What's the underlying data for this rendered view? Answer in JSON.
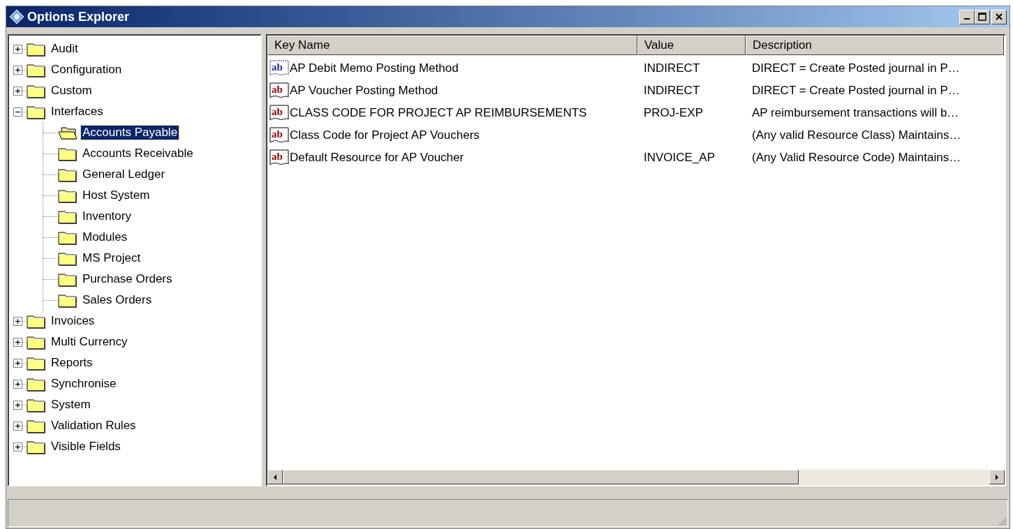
{
  "window": {
    "title": "Options Explorer"
  },
  "tree": [
    {
      "label": "Audit",
      "expanded": false,
      "selected": false
    },
    {
      "label": "Configuration",
      "expanded": false,
      "selected": false
    },
    {
      "label": "Custom",
      "expanded": false,
      "selected": false
    },
    {
      "label": "Interfaces",
      "expanded": true,
      "selected": false,
      "children": [
        {
          "label": "Accounts Payable",
          "selected": true
        },
        {
          "label": "Accounts Receivable",
          "selected": false
        },
        {
          "label": "General Ledger",
          "selected": false
        },
        {
          "label": "Host System",
          "selected": false
        },
        {
          "label": "Inventory",
          "selected": false
        },
        {
          "label": "Modules",
          "selected": false
        },
        {
          "label": "MS Project",
          "selected": false
        },
        {
          "label": "Purchase Orders",
          "selected": false
        },
        {
          "label": "Sales Orders",
          "selected": false
        }
      ]
    },
    {
      "label": "Invoices",
      "expanded": false,
      "selected": false
    },
    {
      "label": "Multi Currency",
      "expanded": false,
      "selected": false
    },
    {
      "label": "Reports",
      "expanded": false,
      "selected": false
    },
    {
      "label": "Synchronise",
      "expanded": false,
      "selected": false
    },
    {
      "label": "System",
      "expanded": false,
      "selected": false
    },
    {
      "label": "Validation Rules",
      "expanded": false,
      "selected": false
    },
    {
      "label": "Visible Fields",
      "expanded": false,
      "selected": false
    }
  ],
  "table": {
    "columns": [
      "Key Name",
      "Value",
      "Description"
    ],
    "rows": [
      {
        "icon_text": "ab",
        "key": "AP Debit Memo Posting Method",
        "value": "INDIRECT",
        "description": "DIRECT = Create Posted journal in P…",
        "focused": true
      },
      {
        "icon_text": "ab",
        "key": "AP Voucher Posting Method",
        "value": "INDIRECT",
        "description": "DIRECT = Create Posted journal in P…",
        "focused": false
      },
      {
        "icon_text": "ab",
        "key": "CLASS CODE FOR PROJECT AP REIMBURSEMENTS",
        "value": "PROJ-EXP",
        "description": "AP reimbursement transactions will b…",
        "focused": false
      },
      {
        "icon_text": "ab",
        "key": "Class Code for Project AP Vouchers",
        "description": "(Any valid Resource Class) Maintains…",
        "focused": false
      },
      {
        "icon_text": "ab",
        "key": "Default Resource for AP Voucher",
        "value": "INVOICE_AP",
        "description": "(Any Valid Resource Code) Maintains…",
        "focused": false
      }
    ]
  }
}
